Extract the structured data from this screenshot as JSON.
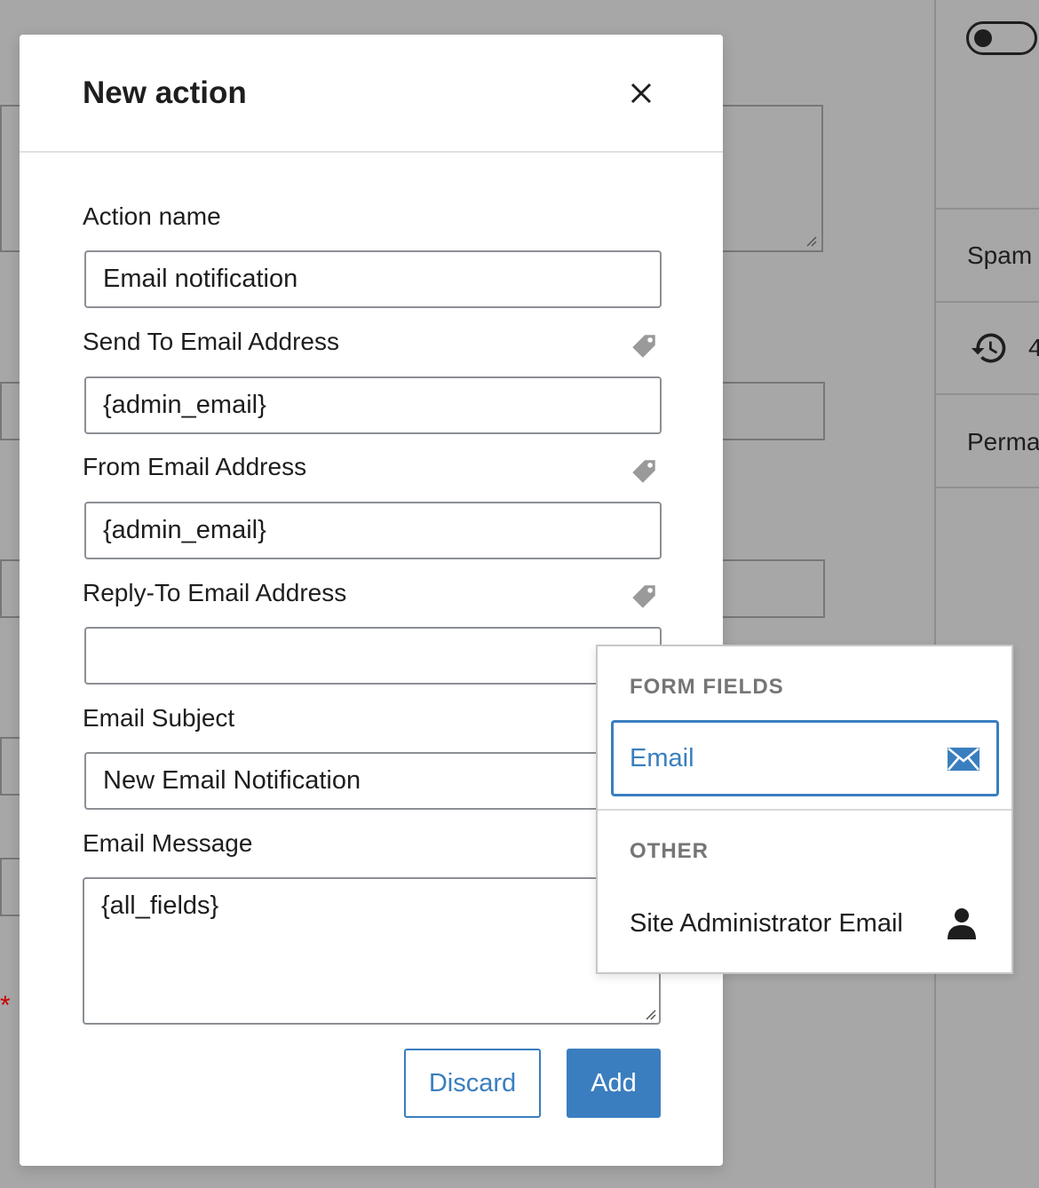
{
  "background": {
    "sidebar_items": [
      "Spam",
      "4",
      "Perma"
    ],
    "required_marker": "*"
  },
  "modal": {
    "title": "New action",
    "fields": [
      {
        "label": "Action name",
        "value": ""
      },
      {
        "label": "Send To Email Address",
        "value": ""
      },
      {
        "label": "From Email Address",
        "value": ""
      },
      {
        "label": "Reply-To Email Address",
        "value": ""
      },
      {
        "label": "Email Subject",
        "value": ""
      },
      {
        "label": "Email Message",
        "value": ""
      }
    ],
    "inputs": {
      "action_name": "Email notification",
      "send_to": "{admin_email}",
      "from": "{admin_email}",
      "reply_to": "",
      "subject": "New Email Notification",
      "message": "{all_fields}"
    },
    "buttons": {
      "discard": "Discard",
      "add": "Add"
    }
  },
  "dropdown": {
    "sections": [
      {
        "heading": "FORM FIELDS",
        "items": [
          {
            "label": "Email",
            "icon": "envelope-icon",
            "selected": true
          }
        ]
      },
      {
        "heading": "OTHER",
        "items": [
          {
            "label": "Site Administrator Email",
            "icon": "user-icon",
            "selected": false
          }
        ]
      }
    ]
  },
  "colors": {
    "accent": "#3a7ebf",
    "overlay": "#a7a7a7"
  }
}
